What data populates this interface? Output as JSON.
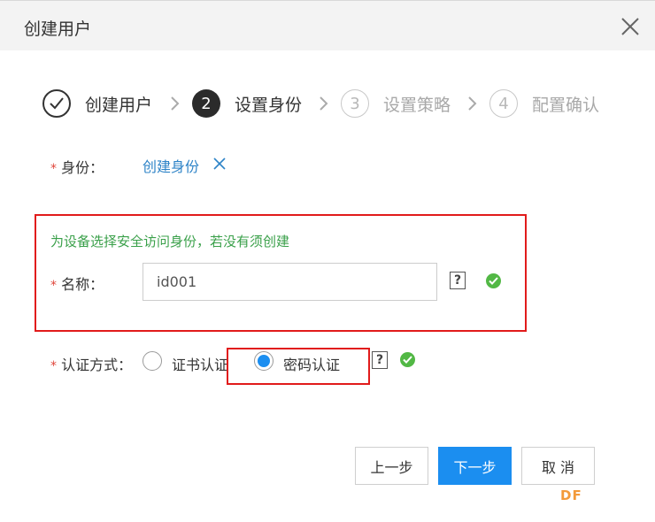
{
  "dialog": {
    "title": "创建用户"
  },
  "steps": [
    {
      "number": "",
      "label": "创建用户",
      "state": "done"
    },
    {
      "number": "2",
      "label": "设置身份",
      "state": "active"
    },
    {
      "number": "3",
      "label": "设置策略",
      "state": "todo"
    },
    {
      "number": "4",
      "label": "配置确认",
      "state": "todo"
    }
  ],
  "form": {
    "required_mark": "*",
    "identity": {
      "label": "身份：",
      "link": "创建身份"
    },
    "hint": "为设备选择安全访问身份，若没有须创建",
    "name": {
      "label": "名称：",
      "value": "id001",
      "help": "?"
    },
    "auth": {
      "label": "认证方式：",
      "options": [
        {
          "label": "证书认证",
          "selected": false
        },
        {
          "label": "密码认证",
          "selected": true
        }
      ],
      "help": "?"
    }
  },
  "buttons": {
    "prev": "上一步",
    "next": "下一步",
    "cancel": "取 消"
  },
  "watermark": "DF",
  "colors": {
    "primary": "#1b8ef0",
    "link": "#2d83c7",
    "success": "#52b845",
    "hint": "#3aa04a",
    "annotation": "#e11b1b",
    "required": "#e0463b"
  }
}
